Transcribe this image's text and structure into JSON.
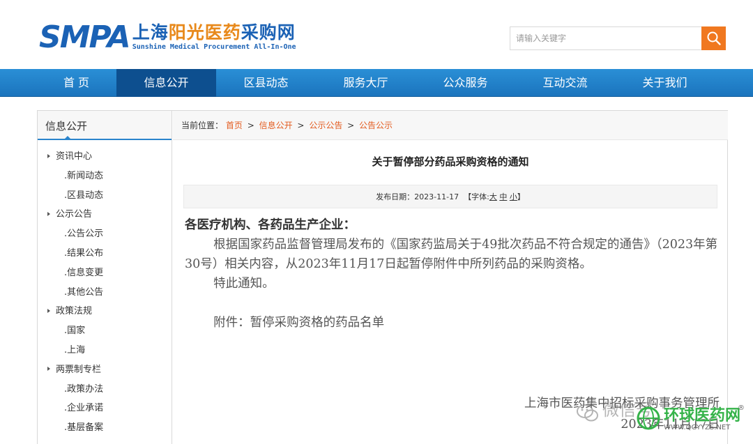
{
  "header": {
    "logo_abbr": "SMPA",
    "logo_cn_part1": "上海",
    "logo_cn_part2": "阳光医药",
    "logo_cn_part3": "采购网",
    "logo_en": "Sunshine Medical Procurement All-In-One",
    "search_placeholder": "请输入关键字",
    "brand_color": "#1b62b5",
    "accent_color": "#f07820"
  },
  "nav": {
    "items": [
      {
        "label": "首 页"
      },
      {
        "label": "信息公开"
      },
      {
        "label": "区县动态"
      },
      {
        "label": "服务大厅"
      },
      {
        "label": "公众服务"
      },
      {
        "label": "互动交流"
      },
      {
        "label": "关于我们"
      }
    ],
    "active_index": 1
  },
  "sidebar": {
    "title": "信息公开",
    "items": [
      {
        "label": "资讯中心",
        "level": "cat"
      },
      {
        "label": ".新闻动态",
        "level": "sub"
      },
      {
        "label": ".区县动态",
        "level": "sub"
      },
      {
        "label": "公示公告",
        "level": "cat"
      },
      {
        "label": ".公告公示",
        "level": "sub"
      },
      {
        "label": ".结果公布",
        "level": "sub"
      },
      {
        "label": ".信息变更",
        "level": "sub"
      },
      {
        "label": ".其他公告",
        "level": "sub"
      },
      {
        "label": "政策法规",
        "level": "cat"
      },
      {
        "label": ".国家",
        "level": "sub"
      },
      {
        "label": ".上海",
        "level": "sub"
      },
      {
        "label": "两票制专栏",
        "level": "cat"
      },
      {
        "label": ".政策办法",
        "level": "sub"
      },
      {
        "label": ".企业承诺",
        "level": "sub"
      },
      {
        "label": ".基层备案",
        "level": "sub"
      }
    ]
  },
  "breadcrumb": {
    "prefix": "当前位置：",
    "items": [
      "首页",
      "信息公开",
      "公示公告",
      "公告公示"
    ],
    "separator": ">"
  },
  "article": {
    "title": "关于暂停部分药品采购资格的通知",
    "date_label": "发布日期：",
    "date": "2023-11-17",
    "font_label": "【字体:",
    "font_large": "大",
    "font_medium": "中",
    "font_small": "小",
    "font_close": "】",
    "greeting": "各医疗机构、各药品生产企业：",
    "paragraph1": "根据国家药品监督管理局发布的《国家药监局关于49批次药品不符合规定的通告》（2023年第30号）相关内容，从2023年11月17日起暂停附件中所列药品的采购资格。",
    "paragraph2": "特此通知。",
    "attachment": "附件：暂停采购资格的药品名单",
    "signature": "上海市医药集中招标采购事务管理所",
    "sign_date": "2023年11月17日"
  },
  "watermark": {
    "wechat": "微信号",
    "site_name": "环球医药网",
    "url": "WWW.QGYYZS.NET",
    "reg": "®"
  }
}
